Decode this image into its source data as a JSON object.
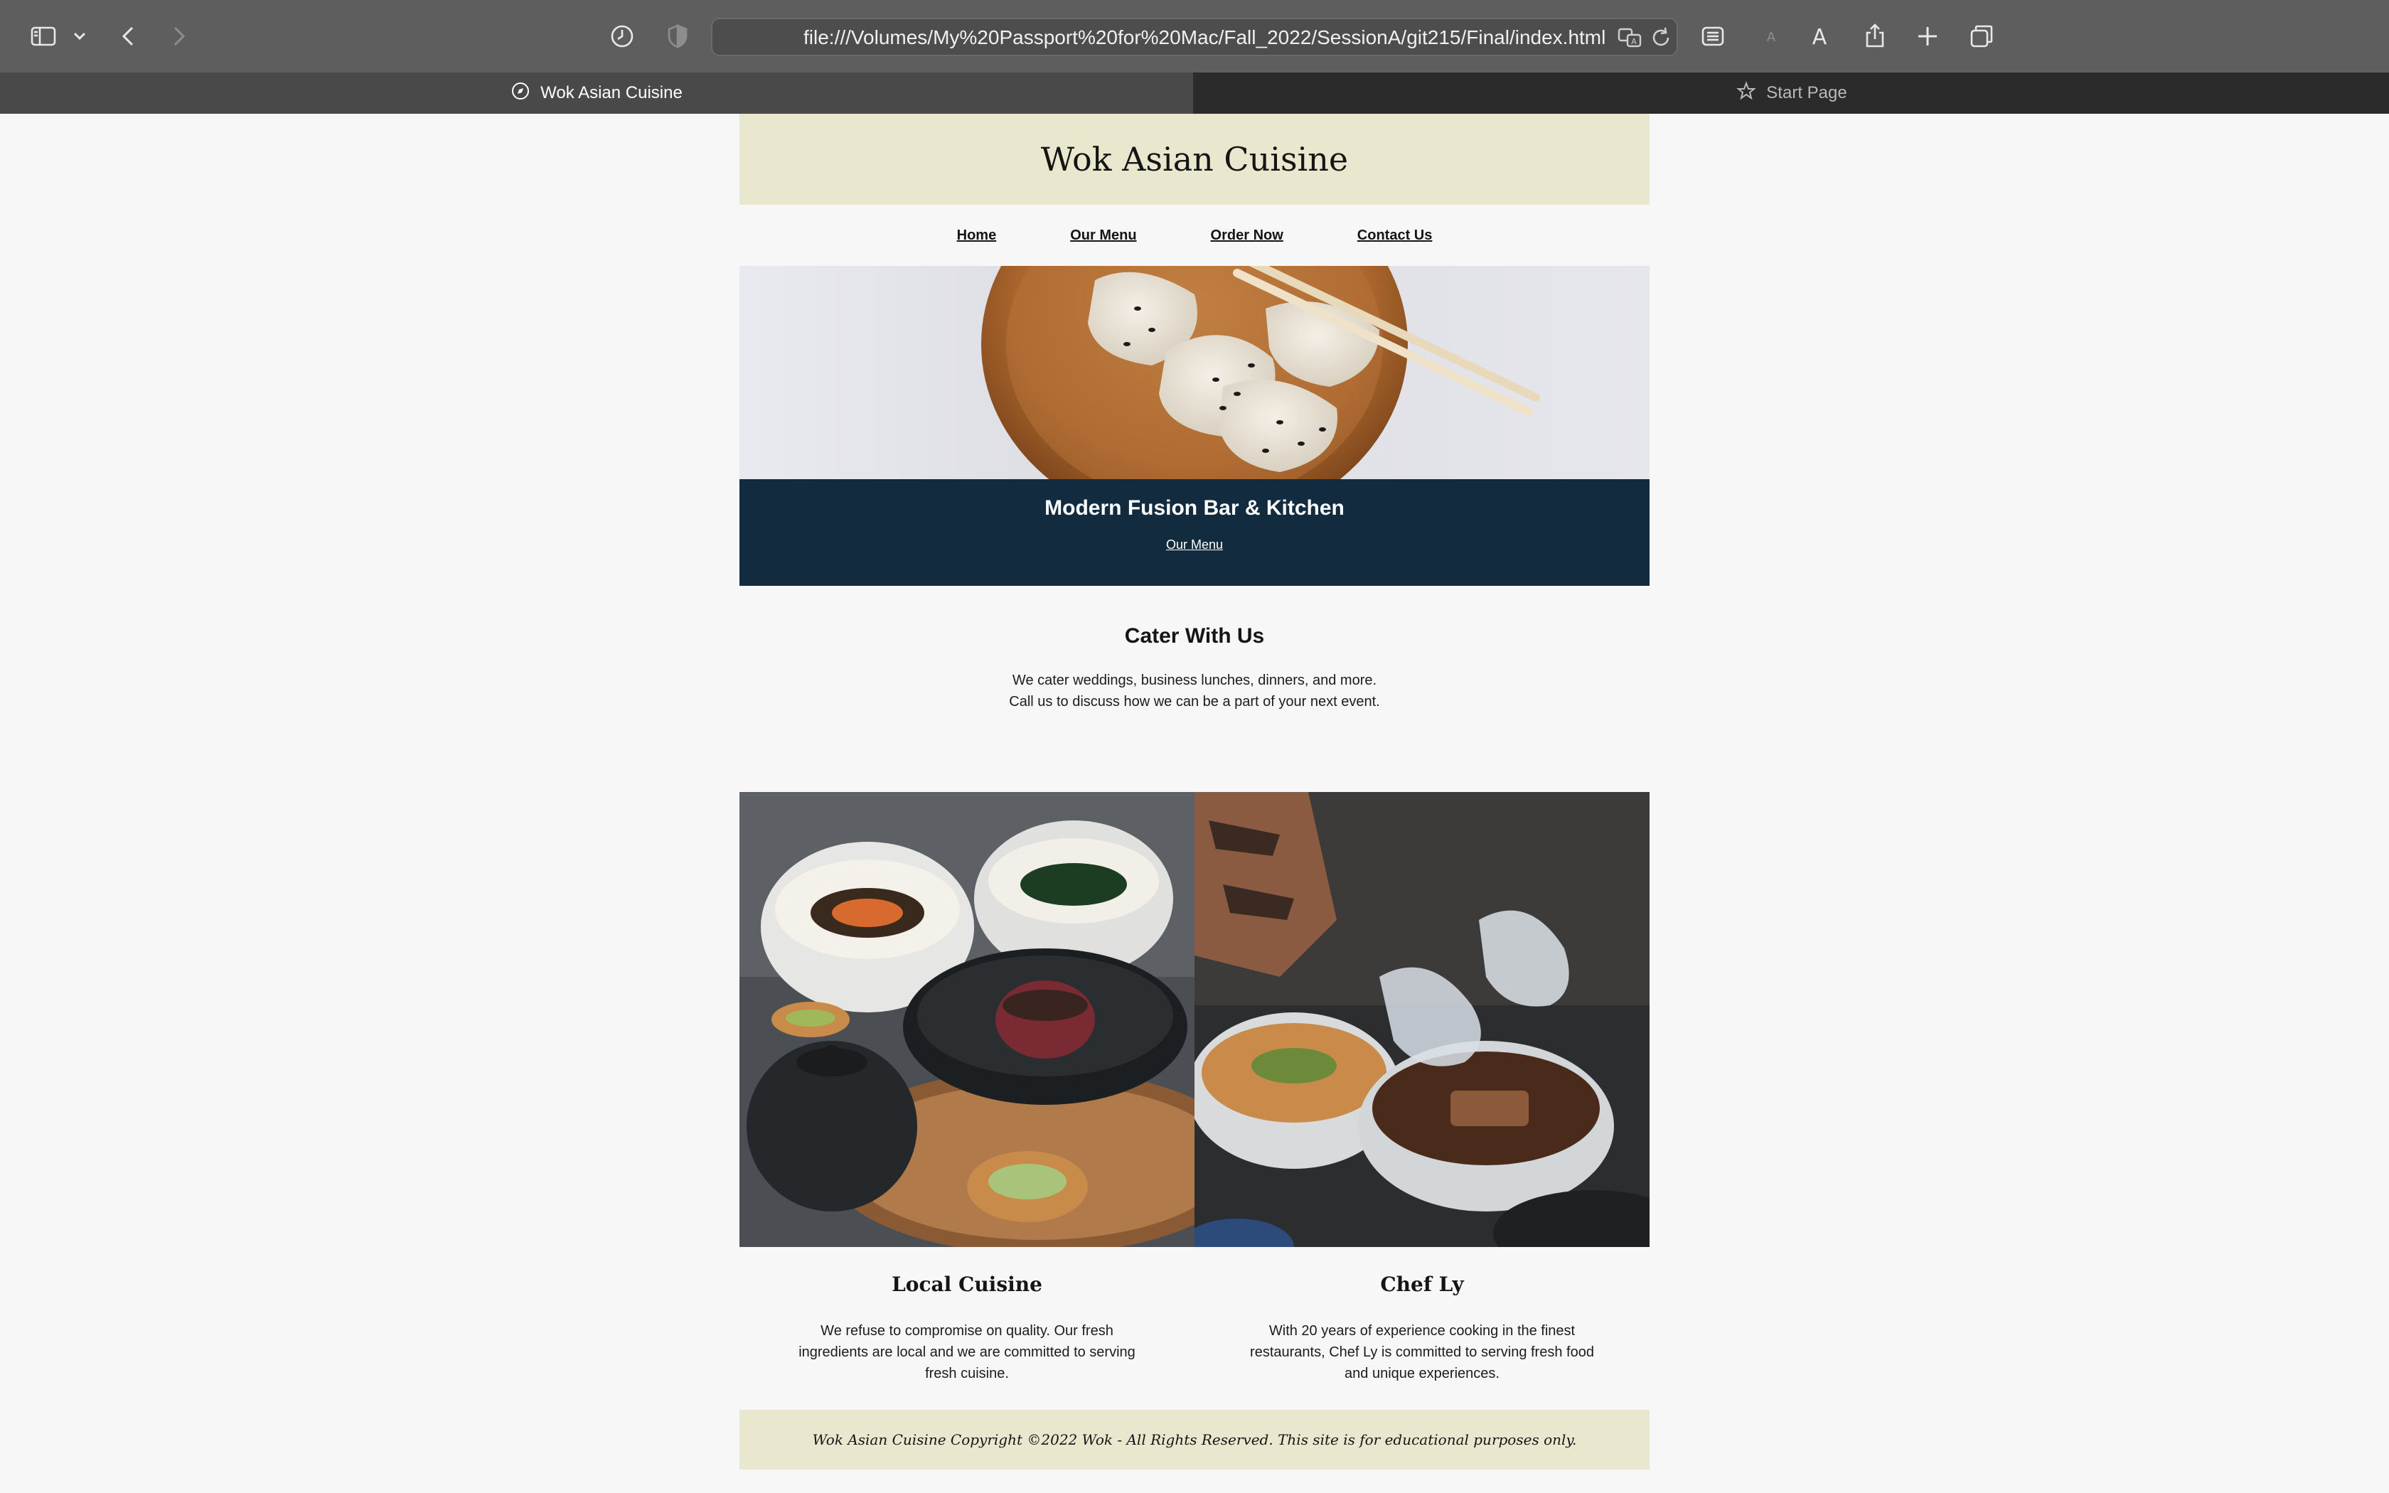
{
  "browser": {
    "url": "file:///Volumes/My%20Passport%20for%20Mac/Fall_2022/SessionA/git215/Final/index.html",
    "tabs": [
      {
        "label": "Wok Asian Cuisine",
        "active": true
      },
      {
        "label": "Start Page",
        "active": false
      }
    ]
  },
  "site": {
    "title": "Wok Asian Cuisine",
    "nav": [
      "Home",
      "Our Menu",
      "Order Now",
      "Contact Us"
    ],
    "banner": {
      "heading": "Modern Fusion Bar & Kitchen",
      "link": "Our Menu"
    },
    "cater": {
      "heading": "Cater With Us",
      "line1": "We cater weddings, business lunches, dinners, and more.",
      "line2": "Call us to discuss how we can be a part of your next event."
    },
    "features": [
      {
        "heading": "Local Cuisine",
        "text": "We refuse to compromise on quality. Our fresh ingredients are local and we are committed to serving fresh cuisine."
      },
      {
        "heading": "Chef Ly",
        "text": "With 20 years of experience cooking in the finest restaurants, Chef Ly is committed to serving fresh food and unique experiences."
      }
    ],
    "footer": "Wok Asian Cuisine Copyright ©2022 Wok - All Rights Reserved. This site is for educational purposes only."
  },
  "colors": {
    "header_bg": "#e9e8cf",
    "banner_bg": "#132b3f",
    "page_bg": "#f7f7f7",
    "toolbar_bg": "#5e5e5e"
  },
  "icons": [
    "sidebar-icon",
    "chevron-down-icon",
    "back-icon",
    "forward-icon",
    "history-icon",
    "shield-icon",
    "translate-icon",
    "reload-icon",
    "reader-icon",
    "text-smaller-icon",
    "text-larger-icon",
    "share-icon",
    "new-tab-icon",
    "tab-overview-icon",
    "compass-icon",
    "star-icon"
  ]
}
